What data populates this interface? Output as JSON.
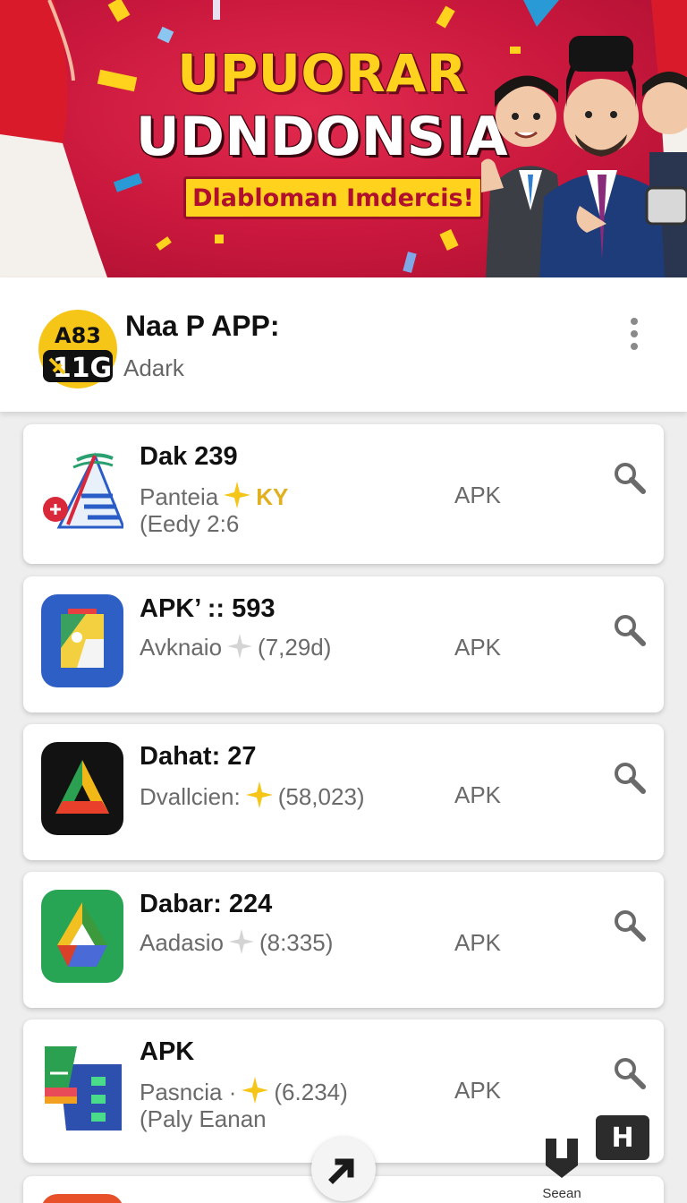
{
  "banner": {
    "title_line1": "UPUORAR",
    "title_line2": "UDNDONSIA",
    "tagline": "Dlabloman Imdercis!",
    "colors": {
      "background": "#c8173c",
      "title1": "#ffd21e",
      "title2": "#ffffff",
      "tag_bg": "#ffd21e"
    }
  },
  "header": {
    "app_name": "Naa P APP:",
    "subtitle": "Adark",
    "logo_text_top": "A83",
    "logo_text_bottom": "11G",
    "menu_icon": "more-vertical-icon"
  },
  "apps": [
    {
      "title": "Dak 239",
      "line1": "Panteia",
      "line1_suffix": "KY",
      "line2": "(Eedy 2:6",
      "apk": "APK",
      "star": "gold"
    },
    {
      "title": "APK’ :: 593",
      "line1": "Avknaio",
      "line1_suffix": "(7,29d)",
      "line2": "",
      "apk": "APK",
      "star": "gray"
    },
    {
      "title": "Dahat: 27",
      "line1": "Dvallcien:",
      "line1_suffix": "(58,023)",
      "line2": "",
      "apk": "APK",
      "star": "gold"
    },
    {
      "title": "Dabar: 224",
      "line1": "Aadasio",
      "line1_suffix": "(8:335)",
      "line2": "",
      "apk": "APK",
      "star": "gray"
    },
    {
      "title": "APK",
      "line1": "Pasncia ·",
      "line1_suffix": "(6.234)",
      "line2": "(Paly Eanan",
      "apk": "APK",
      "star": "gold"
    }
  ],
  "bottom": {
    "nav_label": "Seean",
    "h_button": "H",
    "fab_icon": "arrow-up-icon"
  }
}
